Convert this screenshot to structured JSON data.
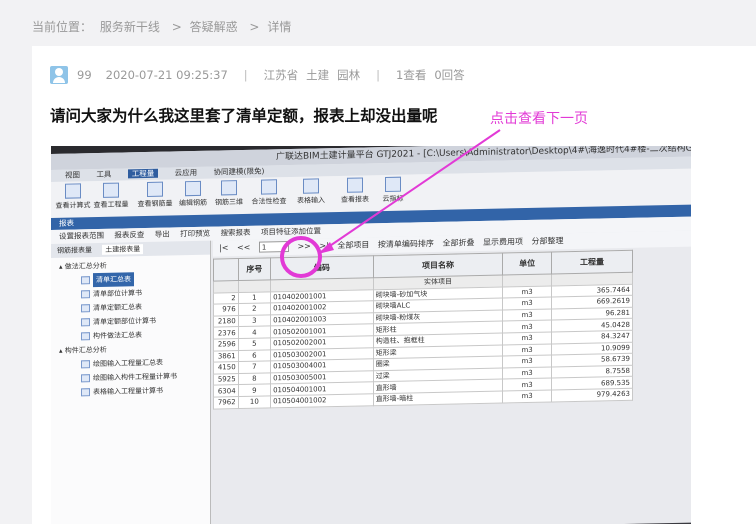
{
  "breadcrumb": {
    "label": "当前位置：",
    "items": [
      "服务新干线",
      "答疑解惑",
      "详情"
    ],
    "separator": ">"
  },
  "post": {
    "author": "99",
    "datetime": "2020-07-21 09:25:37",
    "separator": "|",
    "region": "江苏省",
    "category": "土建",
    "subcategory": "园林",
    "views": "1查看",
    "answers": "0回答",
    "title": "请问大家为什么我这里套了清单定额，报表上却没出量呢",
    "annotation": "点击查看下一页"
  },
  "screenshot": {
    "window_title": "广联达BIM土建计量平台 GTJ2021 - [C:\\Users\\Administrator\\Desktop\\4#\\海逸时代4#楼-二次结构GTJ]",
    "menu": [
      "视图",
      "工具",
      "工程量",
      "云应用",
      "协同建模(限免)"
    ],
    "menu_active": "工程量",
    "ribbon": [
      "查看计算式",
      "查看工程量",
      "查看钢筋量",
      "编辑钢筋",
      "钢筋三维",
      "合法性检查",
      "表格输入",
      "查看报表",
      "云指标"
    ],
    "blue_bar": "报表",
    "toolbar": [
      "设置报表范围",
      "报表反查",
      "导出",
      "打印预览",
      "搜索报表",
      "项目特征添加位置"
    ],
    "left_tabs": [
      "钢筋报表量",
      "土建报表量"
    ],
    "left_tabs_active": "土建报表量",
    "tree": [
      {
        "label": "做法汇总分析",
        "level": 0
      },
      {
        "label": "清单汇总表",
        "level": 1,
        "selected": true
      },
      {
        "label": "清单部位计算书",
        "level": 1
      },
      {
        "label": "清单定额汇总表",
        "level": 1
      },
      {
        "label": "清单定额部位计算书",
        "level": 1
      },
      {
        "label": "构件做法汇总表",
        "level": 1
      },
      {
        "label": "构件汇总分析",
        "level": 0
      },
      {
        "label": "绘图输入工程量汇总表",
        "level": 1
      },
      {
        "label": "绘图输入构件工程量计算书",
        "level": 1
      },
      {
        "label": "表格输入工程量计算书",
        "level": 1
      }
    ],
    "pager": {
      "first": "|<",
      "prev": "<<",
      "page": "1",
      "next": ">>",
      "last": ">|",
      "items": [
        "全部项目",
        "按清单编码排序",
        "全部折叠",
        "显示费用项",
        "分部整理"
      ]
    },
    "table": {
      "headers": [
        "序号",
        "编码",
        "项目名称",
        "单位",
        "工程量"
      ],
      "section": "实体项目",
      "rows": [
        {
          "id": "2",
          "seq": "1",
          "code": "010402001001",
          "name": "砌块墙-砂加气块",
          "unit": "m3",
          "qty": "365.7464"
        },
        {
          "id": "976",
          "seq": "2",
          "code": "010402001002",
          "name": "砌块墙ALC",
          "unit": "m3",
          "qty": "669.2619"
        },
        {
          "id": "2180",
          "seq": "3",
          "code": "010402001003",
          "name": "砌块墙-粉煤灰",
          "unit": "m3",
          "qty": "96.281"
        },
        {
          "id": "2376",
          "seq": "4",
          "code": "010502001001",
          "name": "矩形柱",
          "unit": "m3",
          "qty": "45.0428"
        },
        {
          "id": "2596",
          "seq": "5",
          "code": "010502002001",
          "name": "构造柱、抱框柱",
          "unit": "m3",
          "qty": "84.3247"
        },
        {
          "id": "3861",
          "seq": "6",
          "code": "010503002001",
          "name": "矩形梁",
          "unit": "m3",
          "qty": "10.9099"
        },
        {
          "id": "4150",
          "seq": "7",
          "code": "010503004001",
          "name": "圈梁",
          "unit": "m3",
          "qty": "58.6739"
        },
        {
          "id": "5925",
          "seq": "8",
          "code": "010503005001",
          "name": "过梁",
          "unit": "m3",
          "qty": "8.7558"
        },
        {
          "id": "6304",
          "seq": "9",
          "code": "010504001001",
          "name": "直形墙",
          "unit": "m3",
          "qty": "689.535"
        },
        {
          "id": "7962",
          "seq": "10",
          "code": "010504001002",
          "name": "直形墙-暗柱",
          "unit": "m3",
          "qty": "979.4263"
        }
      ]
    }
  },
  "colors": {
    "annotation": "#e23ad6",
    "accent_blue": "#3264a8"
  }
}
